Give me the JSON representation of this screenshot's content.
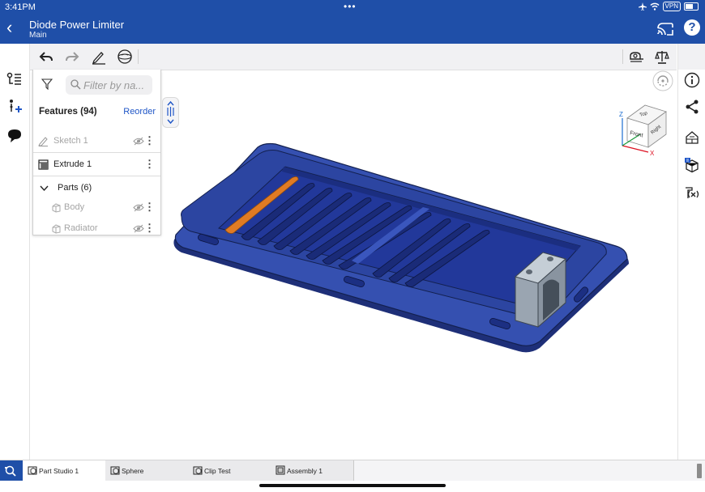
{
  "status_bar": {
    "time": "3:41PM",
    "dots": "•••",
    "vpn": "VPN"
  },
  "header": {
    "title": "Diode Power Limiter",
    "subtitle": "Main"
  },
  "feature_panel": {
    "filter_placeholder": "Filter by na...",
    "features_label": "Features (94)",
    "reorder_label": "Reorder",
    "items": [
      {
        "label": "Sketch 1",
        "icon": "sketch-icon",
        "hidden": true
      },
      {
        "label": "Extrude 1",
        "icon": "extrude-icon",
        "hidden": false
      }
    ],
    "parts_label": "Parts (6)",
    "parts": [
      {
        "label": "Body",
        "icon": "part-icon",
        "hidden": true
      },
      {
        "label": "Radiator",
        "icon": "part-icon",
        "hidden": true
      }
    ]
  },
  "view_cube": {
    "top": "Top",
    "front": "Front",
    "right": "Right",
    "axis_x": "X",
    "axis_z": "Z"
  },
  "tabs": [
    {
      "label": "Part Studio 1",
      "icon": "part-studio-icon",
      "active": true
    },
    {
      "label": "Sphere",
      "icon": "part-studio-icon",
      "active": false
    },
    {
      "label": "Clip Test",
      "icon": "part-studio-icon",
      "active": false
    },
    {
      "label": "Assembly 1",
      "icon": "assembly-icon",
      "active": false
    }
  ],
  "colors": {
    "brand": "#1f4fa8",
    "model_body": "#2e47a0",
    "highlight": "#e07b24",
    "clip": "#a9b4bf",
    "link": "#1f56c7"
  }
}
